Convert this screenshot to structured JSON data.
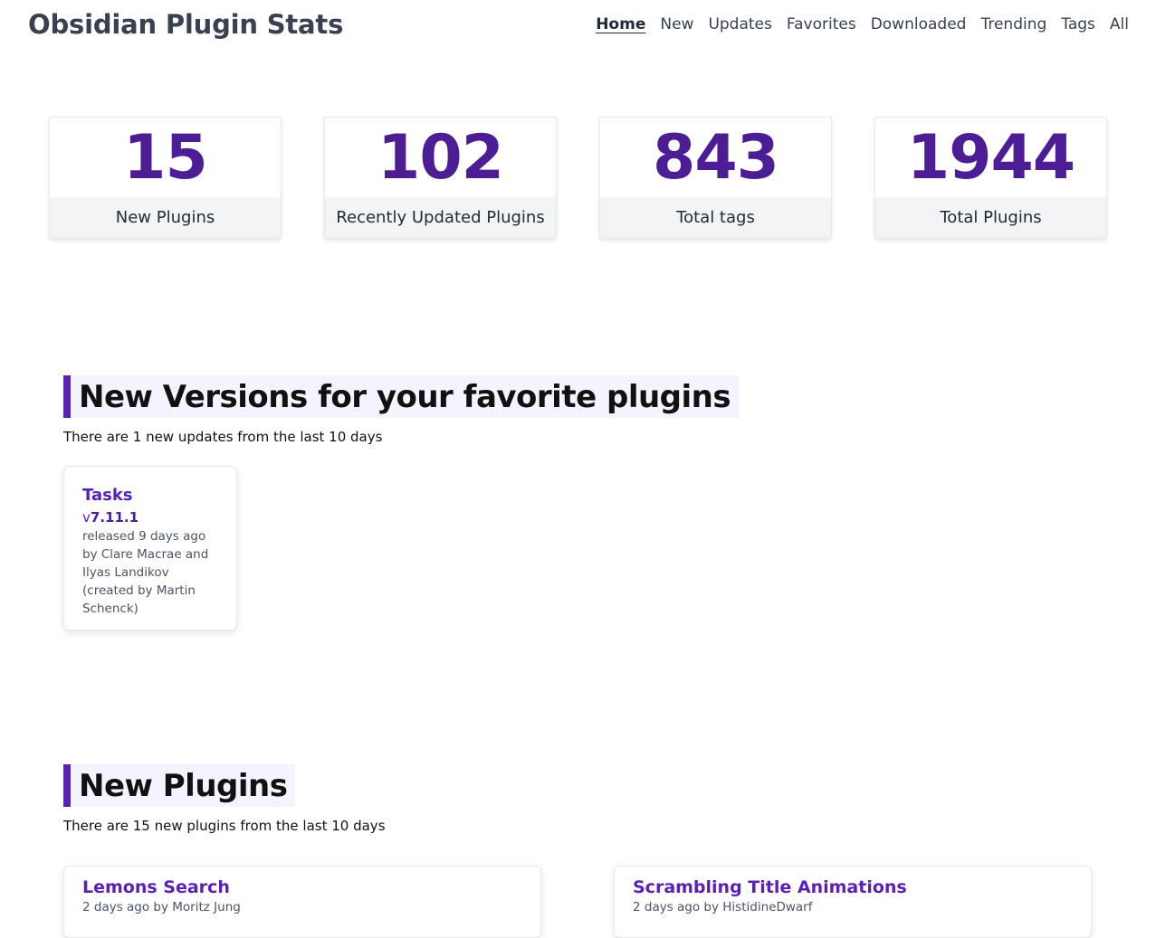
{
  "header": {
    "title": "Obsidian Plugin Stats",
    "nav": [
      "Home",
      "New",
      "Updates",
      "Favorites",
      "Downloaded",
      "Trending",
      "Tags",
      "All"
    ],
    "active_nav": "Home"
  },
  "stats": [
    {
      "value": "15",
      "label": "New Plugins"
    },
    {
      "value": "102",
      "label": "Recently Updated Plugins"
    },
    {
      "value": "843",
      "label": "Total tags"
    },
    {
      "value": "1944",
      "label": "Total Plugins"
    }
  ],
  "favorites_section": {
    "heading": "New Versions for your favorite plugins",
    "subtitle": "There are 1 new updates from the last 10 days",
    "updates": [
      {
        "name": "Tasks",
        "version_prefix": "v",
        "version": "7.11.1",
        "released": "released 9 days ago",
        "by": "by Clare Macrae and Ilyas Landikov (created by Martin Schenck)"
      }
    ]
  },
  "new_plugins_section": {
    "heading": "New Plugins",
    "subtitle": "There are 15 new plugins from the last 10 days",
    "plugins": [
      {
        "name": "Lemons Search",
        "meta": "2 days ago by Moritz Jung"
      },
      {
        "name": "Scrambling Title Animations",
        "meta": "2 days ago by HistidineDwarf"
      }
    ]
  },
  "colors": {
    "accent": "#5b21b6",
    "stat_number": "#4c1d95",
    "heading_bg": "#f5f3ff"
  }
}
